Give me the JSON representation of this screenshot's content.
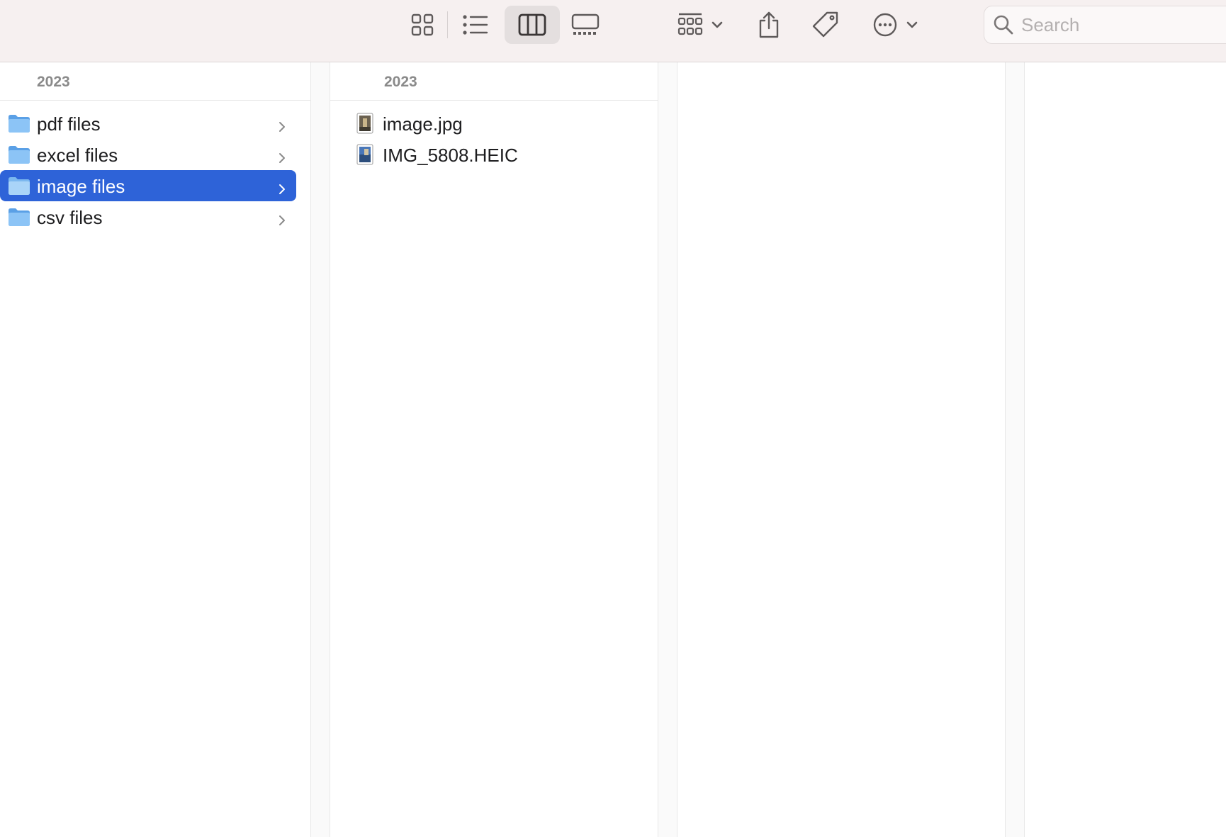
{
  "toolbar": {
    "view_buttons": [
      {
        "name": "icon-view",
        "icon": "grid-icon",
        "active": false
      },
      {
        "name": "list-view",
        "icon": "list-icon",
        "active": false
      },
      {
        "name": "column-view",
        "icon": "columns-icon",
        "active": true
      },
      {
        "name": "gallery-view",
        "icon": "gallery-icon",
        "active": false
      }
    ],
    "group_icon": "group-by-icon",
    "share_icon": "share-icon",
    "tag_icon": "tag-icon",
    "more_icon": "ellipsis-circle-icon",
    "search": {
      "placeholder": "Search",
      "value": ""
    }
  },
  "columns": [
    {
      "header": "2023",
      "items": [
        {
          "label": "pdf files",
          "icon": "folder-icon",
          "selected": false
        },
        {
          "label": "excel files",
          "icon": "folder-icon",
          "selected": false
        },
        {
          "label": "image files",
          "icon": "folder-icon",
          "selected": true
        },
        {
          "label": "csv files",
          "icon": "folder-icon",
          "selected": false
        }
      ]
    },
    {
      "header": "2023",
      "items": [
        {
          "label": "image.jpg",
          "icon": "image-thumbnail-icon"
        },
        {
          "label": "IMG_5808.HEIC",
          "icon": "image-thumbnail-icon"
        }
      ]
    }
  ],
  "colors": {
    "selection": "#2e63d8",
    "folder": "#6fb1f0",
    "toolbar_bg": "#f6f0f0"
  }
}
